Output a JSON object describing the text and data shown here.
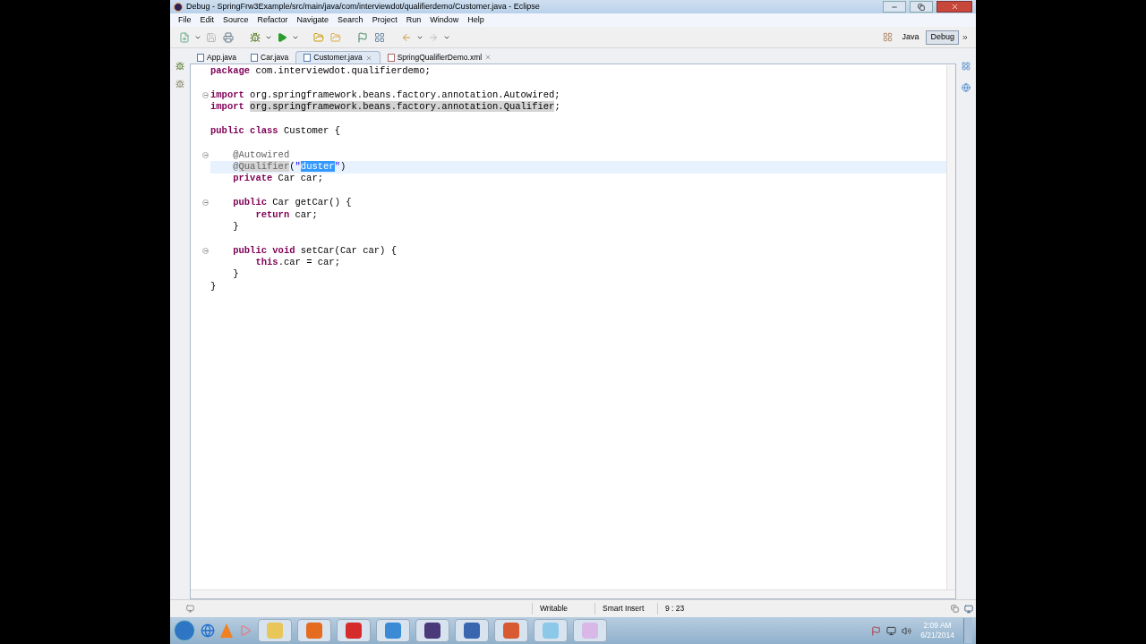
{
  "window": {
    "title": "Debug - SpringFrw3Example/src/main/java/com/interviewdot/qualifierdemo/Customer.java - Eclipse"
  },
  "menu": [
    "File",
    "Edit",
    "Source",
    "Refactor",
    "Navigate",
    "Search",
    "Project",
    "Run",
    "Window",
    "Help"
  ],
  "perspectives": [
    {
      "label": "Java",
      "selected": false
    },
    {
      "label": "Debug",
      "selected": true
    }
  ],
  "tabs": [
    {
      "label": "App.java",
      "kind": "java",
      "selected": false,
      "closable": false
    },
    {
      "label": "Car.java",
      "kind": "java",
      "selected": false,
      "closable": false
    },
    {
      "label": "Customer.java",
      "kind": "java",
      "selected": true,
      "closable": true
    },
    {
      "label": "SpringQualifierDemo.xml",
      "kind": "xml",
      "selected": false,
      "closable": true
    }
  ],
  "editor": {
    "lines": [
      {
        "fold_marker": false,
        "current": false,
        "segments": [
          {
            "kind": "kw",
            "text": "package"
          },
          {
            "kind": "text",
            "text": " com.interviewdot.qualifierdemo;"
          }
        ]
      },
      {
        "fold_marker": false,
        "current": false
      },
      {
        "fold_marker": true,
        "current": false,
        "segments": [
          {
            "kind": "kw",
            "text": "import"
          },
          {
            "kind": "text",
            "text": " org.springframework.beans.factory.annotation.Autowired;"
          }
        ]
      },
      {
        "fold_marker": false,
        "current": false,
        "segments": [
          {
            "kind": "kw",
            "text": "import "
          },
          {
            "kind": "occurrence",
            "text": "org.springframework.beans.factory.annotation.Qualifier"
          },
          {
            "kind": "text",
            "text": ";"
          }
        ]
      },
      {
        "fold_marker": false,
        "current": false
      },
      {
        "fold_marker": false,
        "current": false,
        "segments": [
          {
            "kind": "kw",
            "text": "public class"
          },
          {
            "kind": "text",
            "text": " Customer {"
          }
        ]
      },
      {
        "fold_marker": false,
        "current": false
      },
      {
        "fold_marker": true,
        "current": false,
        "segments": [
          {
            "kind": "annotation",
            "text": "    @Autowired"
          }
        ]
      },
      {
        "fold_marker": false,
        "current": true,
        "segments": [
          {
            "kind": "annotation",
            "text": "    @"
          },
          {
            "kind": "annotation_occurrence",
            "text": "Qualifier"
          },
          {
            "kind": "text",
            "text": "("
          },
          {
            "kind": "string",
            "text": "\""
          },
          {
            "kind": "selection",
            "text": "duster"
          },
          {
            "kind": "string",
            "text": "\""
          },
          {
            "kind": "text",
            "text": ")"
          }
        ]
      },
      {
        "fold_marker": false,
        "current": false,
        "segments": [
          {
            "kind": "kw",
            "text": "    private"
          },
          {
            "kind": "text",
            "text": " Car car;"
          }
        ]
      },
      {
        "fold_marker": false,
        "current": false
      },
      {
        "fold_marker": true,
        "current": false,
        "segments": [
          {
            "kind": "kw",
            "text": "    public"
          },
          {
            "kind": "text",
            "text": " Car getCar() {"
          }
        ]
      },
      {
        "fold_marker": false,
        "current": false,
        "segments": [
          {
            "kind": "kw",
            "text": "        return"
          },
          {
            "kind": "text",
            "text": " car;"
          }
        ]
      },
      {
        "fold_marker": false,
        "current": false,
        "segments": [
          {
            "kind": "text",
            "text": "    }"
          }
        ]
      },
      {
        "fold_marker": false,
        "current": false
      },
      {
        "fold_marker": true,
        "current": false,
        "segments": [
          {
            "kind": "kw",
            "text": "    public void"
          },
          {
            "kind": "text",
            "text": " setCar(Car car) {"
          }
        ]
      },
      {
        "fold_marker": false,
        "current": false,
        "segments": [
          {
            "kind": "kw",
            "text": "        this"
          },
          {
            "kind": "text",
            "text": ".car = car;"
          }
        ]
      },
      {
        "fold_marker": false,
        "current": false,
        "segments": [
          {
            "kind": "text",
            "text": "    }"
          }
        ]
      },
      {
        "fold_marker": false,
        "current": false,
        "segments": [
          {
            "kind": "text",
            "text": "}"
          }
        ]
      }
    ]
  },
  "status_bar": [
    "Writable",
    "Smart Insert",
    "9 : 23"
  ],
  "clock": {
    "time": "2:09 AM",
    "date": "6/21/2014"
  }
}
